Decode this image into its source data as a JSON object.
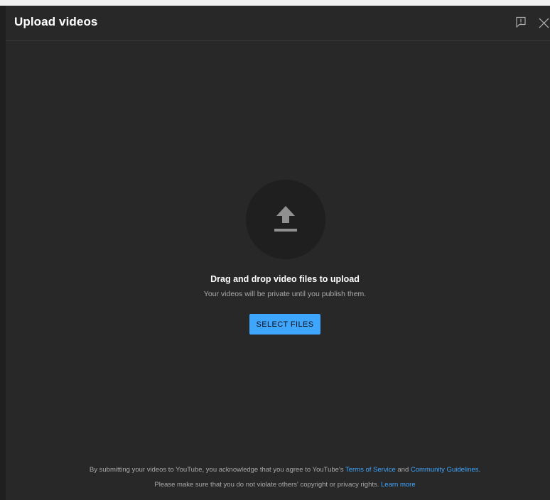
{
  "dialog": {
    "title": "Upload videos",
    "feedback_icon": "feedback-icon",
    "close_icon": "close-icon"
  },
  "dropzone": {
    "icon": "upload-arrow-icon",
    "title": "Drag and drop video files to upload",
    "subtitle": "Your videos will be private until you publish them.",
    "button_label": "SELECT FILES"
  },
  "footer": {
    "line1_prefix": "By submitting your videos to YouTube, you acknowledge that you agree to YouTube's ",
    "terms_link": "Terms of Service",
    "line1_and": " and ",
    "guidelines_link": "Community Guidelines",
    "line1_suffix": ".",
    "line2_prefix": "Please make sure that you do not violate others' copyright or privacy rights. ",
    "learn_more_link": "Learn more"
  },
  "colors": {
    "background": "#282828",
    "accent": "#3ea6ff",
    "secondary_text": "#aaaaaa"
  }
}
